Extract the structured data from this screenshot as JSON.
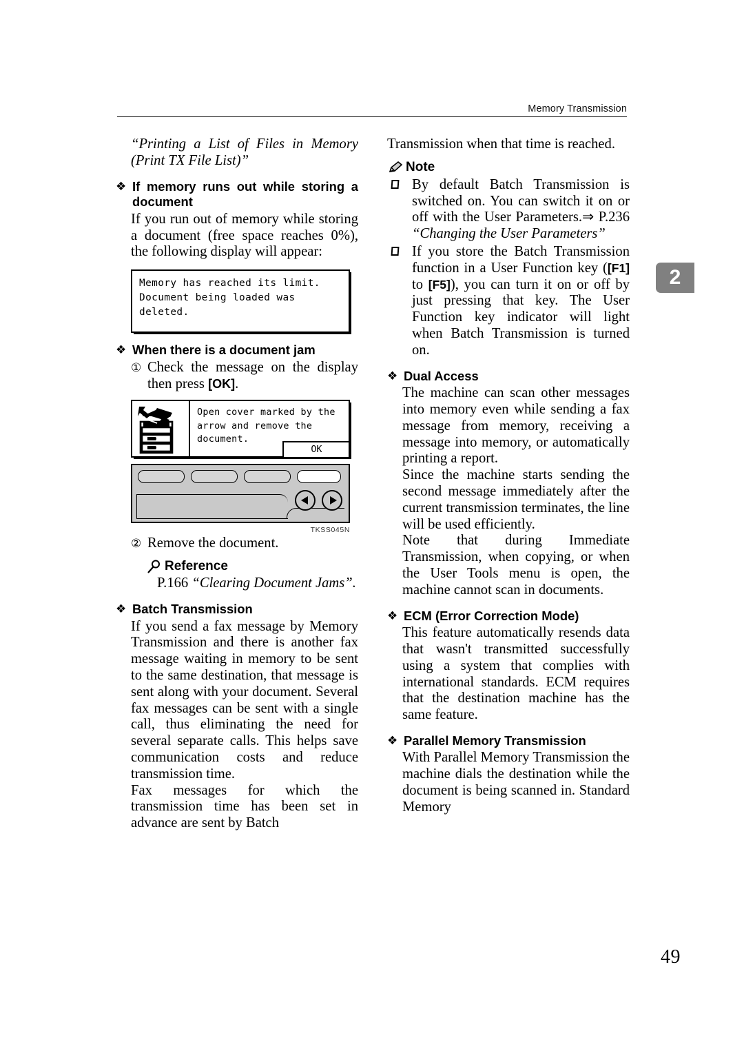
{
  "header": {
    "running_title": "Memory Transmission"
  },
  "chapter_tab": {
    "number": "2",
    "color": "#808080"
  },
  "page_number": "49",
  "left_column": {
    "continued_quote": "“Printing a List of Files in Memory (Print TX File List)”",
    "section_memory_out": {
      "bullet": "❖",
      "heading": "If memory runs out while storing a document",
      "body": "If you run out of memory while storing a document (free space reaches 0%), the following display will appear:"
    },
    "lcd_memory_limit": {
      "line1": "Memory has reached its limit.",
      "line2": "Document being loaded was deleted."
    },
    "section_document_jam": {
      "bullet": "❖",
      "heading": "When there is a document jam",
      "step1_number": "①",
      "step1_text_before": "Check the message on the display then press ",
      "step1_key": "[OK]",
      "step1_text_after": ".",
      "step2_number": "②",
      "step2_text": "Remove the document."
    },
    "lcd_jam": {
      "icon_name": "copier-jam-illustration",
      "line1": "Open cover marked by the",
      "line2": "arrow and remove the",
      "line3": "document.",
      "ok_button": "OK",
      "figure_caption": "TKSS045N"
    },
    "reference_block": {
      "icon_name": "magnifier-icon",
      "heading": "Reference",
      "page_ref": "P.166",
      "title": "“Clearing Document Jams”."
    },
    "section_batch": {
      "bullet": "❖",
      "heading": "Batch Transmission",
      "para1": "If you send a fax message by Memory Transmission and there is another fax message waiting in memory to be sent to the same destination, that message is sent along with your document. Several fax messages can be sent with a single call, thus eliminating the need for several separate calls. This helps save communication costs and reduce transmission time.",
      "para2": "Fax messages for which the transmission time has been set in advance are sent by Batch"
    }
  },
  "right_column": {
    "continued_para": "Transmission when that time is reached.",
    "note_block": {
      "icon_name": "pencil-note-icon",
      "heading": "Note",
      "items": [
        {
          "text_1": "By default Batch Transmission is switched on. You can switch it on or off with the User Parameters.",
          "arrow": "⇒",
          "page_ref": "P.236",
          "title": "“Changing the User Parameters”"
        },
        {
          "text_1": "If you store the Batch Transmission function in a User Function key (",
          "key_a": "[F1]",
          "mid": " to ",
          "key_b": "[F5]",
          "text_2": "), you can turn it on or off by just pressing that key. The User Function key indicator will light when Batch Transmission is turned on."
        }
      ]
    },
    "section_dual_access": {
      "bullet": "❖",
      "heading": "Dual Access",
      "para1": "The machine can scan other messages into memory even while sending a fax message from memory, receiving a message into memory, or automatically printing a report.",
      "para2": "Since the machine starts sending the second message immediately after the current transmission terminates, the line will be used efficiently.",
      "para3": "Note that during Immediate Transmission, when copying, or when the User Tools menu is open, the machine cannot scan in documents."
    },
    "section_ecm": {
      "bullet": "❖",
      "heading": "ECM (Error Correction Mode)",
      "para1": "This feature automatically resends data that wasn't transmitted successfully using a system that complies with international standards. ECM requires that the destination machine has the same feature."
    },
    "section_parallel": {
      "bullet": "❖",
      "heading": "Parallel Memory Transmission",
      "para1": "With Parallel Memory Transmission the machine dials the destination while the document is being scanned in. Standard Memory"
    }
  }
}
